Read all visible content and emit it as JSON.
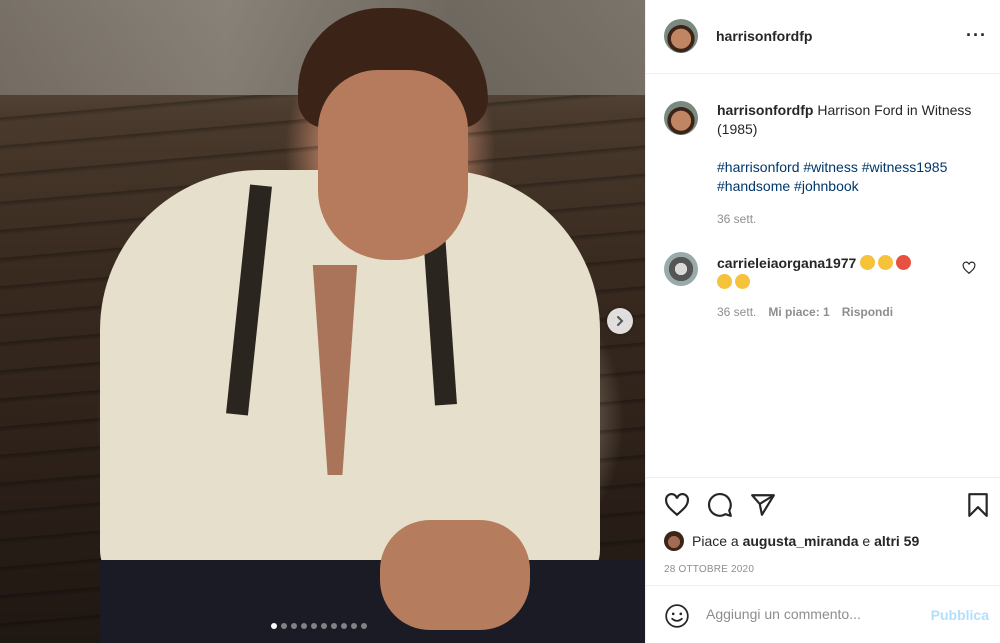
{
  "post": {
    "username": "harrisonfordfp",
    "more_icon": "more-horizontal-icon"
  },
  "caption": {
    "username": "harrisonfordfp",
    "text": "Harrison Ford in Witness (1985)",
    "hashtags": "#harrisonford #witness #witness1985 #handsome #johnbook",
    "time": "36 sett."
  },
  "comment": {
    "username": "carrieleiaorgana1977",
    "emojis": [
      "smiling-face-with-hearts",
      "relieved-face",
      "pouting-face",
      "pleading-face",
      "face-blowing-kiss"
    ],
    "time": "36 sett.",
    "likes": "Mi piace: 1",
    "reply": "Rispondi"
  },
  "likes": {
    "prefix": "Piace a",
    "user": "augusta_miranda",
    "connector": "e",
    "others": "altri 59"
  },
  "date": "28 OTTOBRE 2020",
  "add_comment": {
    "placeholder": "Aggiungi un commento...",
    "publish": "Pubblica"
  },
  "carousel": {
    "total": 10,
    "active": 0
  },
  "colors": {
    "link": "#00376b",
    "muted": "#8e8e8e",
    "publish_disabled": "#b2dffc"
  }
}
